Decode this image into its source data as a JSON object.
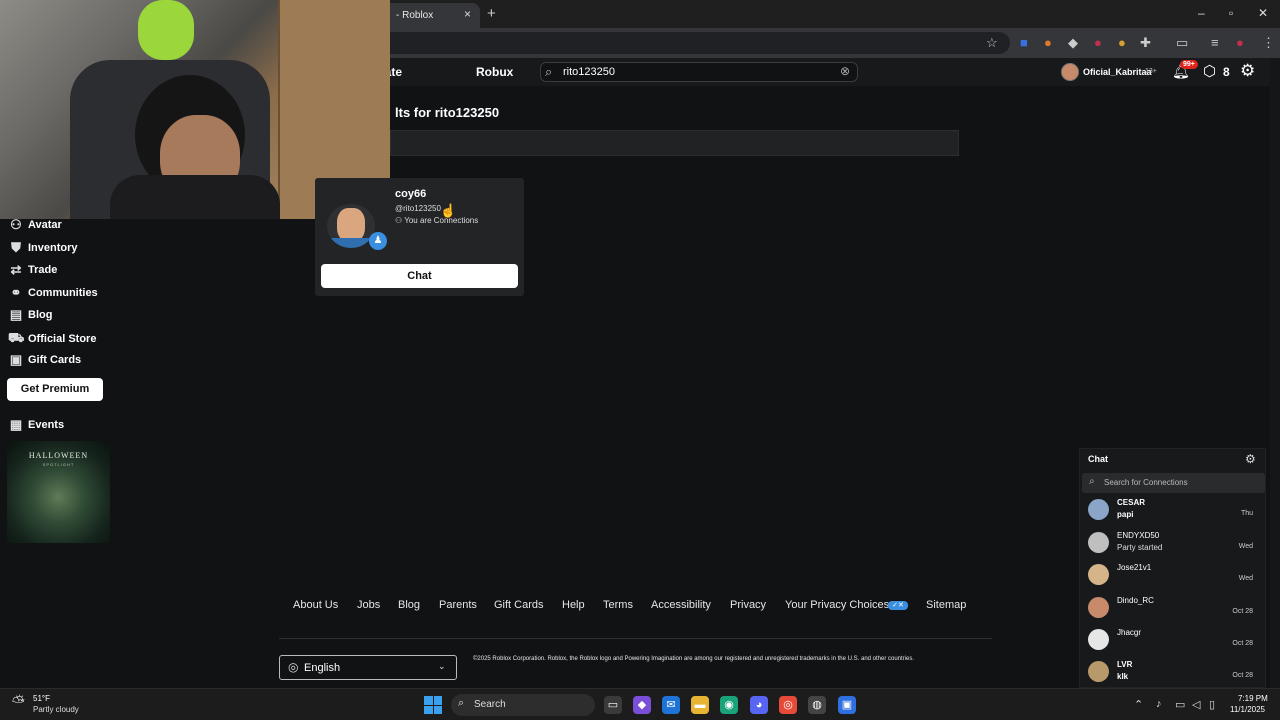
{
  "browser": {
    "tab_title": "- Roblox",
    "tab_close": "×",
    "new_tab": "+",
    "window_controls": [
      "–",
      "▫",
      "✕"
    ]
  },
  "header": {
    "nav": [
      "eate",
      "Robux"
    ],
    "search_value": "rito123250",
    "username": "Oficial_Kabritaa",
    "age_tag": "13+",
    "notifications": "99+",
    "robux_count": "8"
  },
  "sidebar": {
    "items": [
      {
        "label": "Avatar",
        "icon": "avatar-icon"
      },
      {
        "label": "Inventory",
        "icon": "inventory-icon"
      },
      {
        "label": "Trade",
        "icon": "trade-icon"
      },
      {
        "label": "Communities",
        "icon": "communities-icon"
      },
      {
        "label": "Blog",
        "icon": "blog-icon"
      },
      {
        "label": "Official Store",
        "icon": "cart-icon"
      },
      {
        "label": "Gift Cards",
        "icon": "gift-card-icon"
      }
    ],
    "premium_button": "Get Premium",
    "events_label": "Events",
    "banner_title": "HALLOWEEN",
    "banner_subtitle": "SPOTLIGHT"
  },
  "results": {
    "title": "lts for rito123250",
    "card": {
      "display_name": "coy66",
      "handle": "@rito123250",
      "status": "You are Connections",
      "chat_button": "Chat"
    }
  },
  "footer": {
    "links": [
      "About Us",
      "Jobs",
      "Blog",
      "Parents",
      "Gift Cards",
      "Help",
      "Terms",
      "Accessibility",
      "Privacy",
      "Your Privacy Choices",
      "Sitemap"
    ],
    "language": "English",
    "copyright": "©2025 Roblox Corporation. Roblox, the Roblox logo and Powering Imagination are among our registered and unregistered trademarks in the U.S. and other countries."
  },
  "chat": {
    "title": "Chat",
    "search_placeholder": "Search for Connections",
    "conversations": [
      {
        "name": "CESAR",
        "message": "papi",
        "time": "Thu"
      },
      {
        "name": "ENDYXD50",
        "message": "Party started",
        "time": "Wed"
      },
      {
        "name": "Jose21v1",
        "message": "",
        "time": "Wed"
      },
      {
        "name": "Dindo_RC",
        "message": "",
        "time": "Oct 28"
      },
      {
        "name": "Jhacgr",
        "message": "",
        "time": "Oct 28"
      },
      {
        "name": "LVR",
        "message": "klk",
        "time": "Oct 28"
      }
    ]
  },
  "taskbar": {
    "temperature": "51°F",
    "weather": "Partly cloudy",
    "search_label": "Search",
    "time": "7:19 PM",
    "date": "11/1/2025"
  },
  "colors": {
    "background": "#111214",
    "accent_blue": "#3a8fe0",
    "badge_red": "#e2231a"
  }
}
